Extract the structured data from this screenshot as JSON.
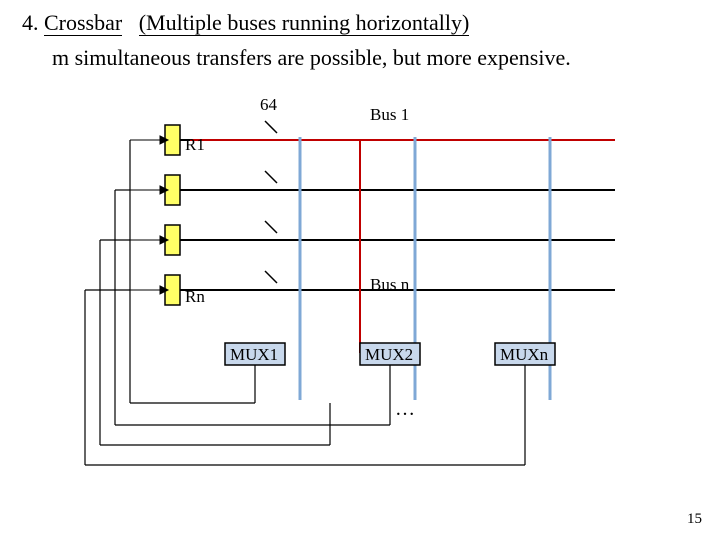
{
  "heading_num": "4.",
  "heading_term": "Crossbar",
  "heading_paren": "(Multiple buses running horizontally)",
  "subheading": "m simultaneous transfers are possible, but more expensive.",
  "buswidth": "64",
  "bus1": "Bus 1",
  "busn": "Bus n",
  "r1": "R1",
  "rn": "Rn",
  "mux1": "MUX1",
  "mux2": "MUX2",
  "muxn": "MUXn",
  "dots": "…",
  "pagenum": "15"
}
